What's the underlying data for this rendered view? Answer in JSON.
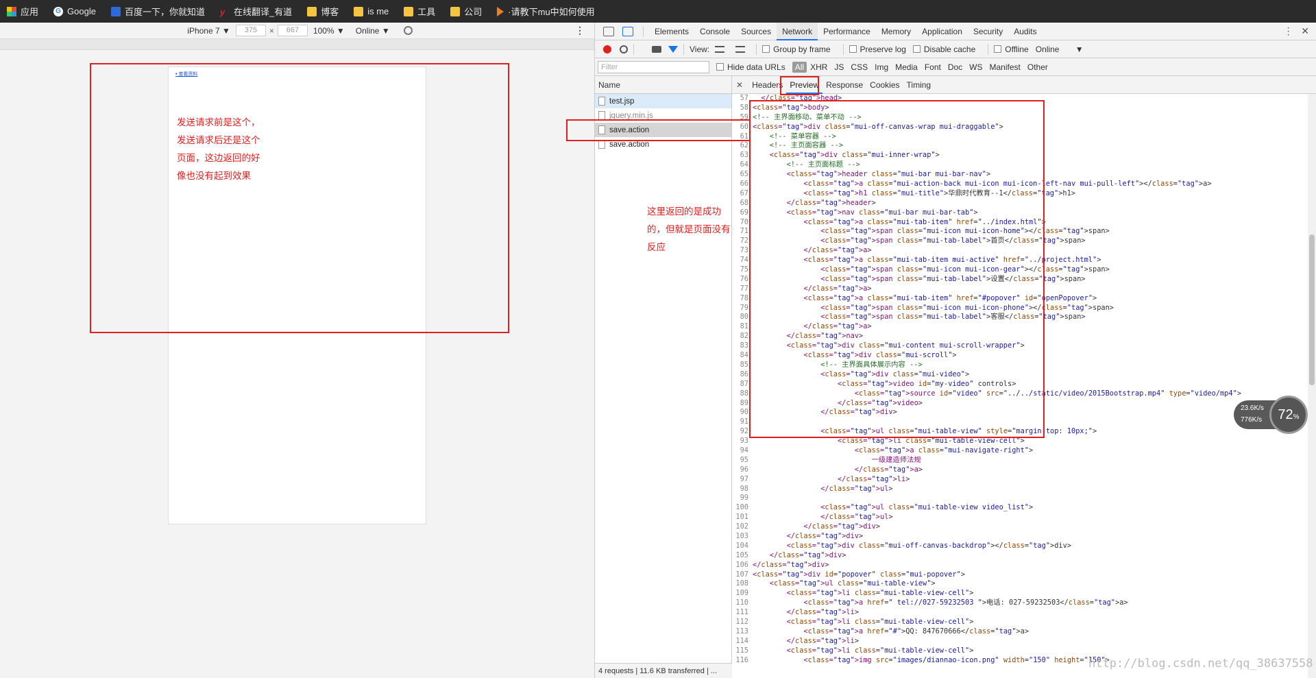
{
  "bookmarks": [
    {
      "label": "应用",
      "icon": "apps-icon"
    },
    {
      "label": "Google",
      "icon": "google-icon"
    },
    {
      "label": "百度一下，你就知道",
      "icon": "baidu-icon"
    },
    {
      "label": "在线翻译_有道",
      "icon": "youdao-icon"
    },
    {
      "label": "博客",
      "icon": "folder-icon"
    },
    {
      "label": "is me",
      "icon": "folder-icon"
    },
    {
      "label": "工具",
      "icon": "folder-icon"
    },
    {
      "label": "公司",
      "icon": "folder-icon"
    },
    {
      "label": "·请教下mu中如何使用",
      "icon": "bookmark-icon"
    }
  ],
  "device": {
    "model": "iPhone 7 ▼",
    "width": "375",
    "x": "×",
    "height": "667",
    "zoom": "100% ▼",
    "network": "Online ▼",
    "page_link": "查看资料"
  },
  "devtools": {
    "tabs": [
      "Elements",
      "Console",
      "Sources",
      "Network",
      "Performance",
      "Memory",
      "Application",
      "Security",
      "Audits"
    ],
    "toolbar": {
      "view": "View:",
      "group_by_frame": "Group by frame",
      "preserve_log": "Preserve log",
      "disable_cache": "Disable cache",
      "offline": "Offline",
      "online": "Online"
    },
    "filter_placeholder": "Filter",
    "hide_data_urls": "Hide data URLs",
    "types": [
      "All",
      "XHR",
      "JS",
      "CSS",
      "Img",
      "Media",
      "Font",
      "Doc",
      "WS",
      "Manifest",
      "Other"
    ],
    "name_header": "Name",
    "requests": [
      "test.jsp",
      "jquery.min.js",
      "save.action",
      "save.action"
    ],
    "status": "4 requests | 11.6 KB transferred | ...",
    "detail_tabs": [
      "Headers",
      "Preview",
      "Response",
      "Cookies",
      "Timing"
    ]
  },
  "code_lines": [
    {
      "n": "57",
      "h": "  </head>"
    },
    {
      "n": "58",
      "h": "<body>"
    },
    {
      "n": "59",
      "h": "<!-- 主界面移动、菜单不动 -->"
    },
    {
      "n": "60",
      "h": "<div class=\"mui-off-canvas-wrap mui-draggable\">"
    },
    {
      "n": "61",
      "h": "    <!-- 菜单容器 -->"
    },
    {
      "n": "62",
      "h": "    <!-- 主页面容器 -->"
    },
    {
      "n": "63",
      "h": "    <div class=\"mui-inner-wrap\">"
    },
    {
      "n": "64",
      "h": "        <!-- 主页面标题 -->"
    },
    {
      "n": "65",
      "h": "        <header class=\"mui-bar mui-bar-nav\">"
    },
    {
      "n": "66",
      "h": "            <a class=\"mui-action-back mui-icon mui-icon-left-nav mui-pull-left\"></a>"
    },
    {
      "n": "67",
      "h": "            <h1 class=\"mui-title\">华鼎时代教育--1</h1>"
    },
    {
      "n": "68",
      "h": "        </header>"
    },
    {
      "n": "69",
      "h": "        <nav class=\"mui-bar mui-bar-tab\">"
    },
    {
      "n": "70",
      "h": "            <a class=\"mui-tab-item\" href=\"../index.html\">"
    },
    {
      "n": "71",
      "h": "                <span class=\"mui-icon mui-icon-home\"></span>"
    },
    {
      "n": "72",
      "h": "                <span class=\"mui-tab-label\">首页</span>"
    },
    {
      "n": "73",
      "h": "            </a>"
    },
    {
      "n": "74",
      "h": "            <a class=\"mui-tab-item mui-active\" href=\"../project.html\">"
    },
    {
      "n": "75",
      "h": "                <span class=\"mui-icon mui-icon-gear\"></span>"
    },
    {
      "n": "76",
      "h": "                <span class=\"mui-tab-label\">设置</span>"
    },
    {
      "n": "77",
      "h": "            </a>"
    },
    {
      "n": "78",
      "h": "            <a class=\"mui-tab-item\" href=\"#popover\" id=\"openPopover\">"
    },
    {
      "n": "79",
      "h": "                <span class=\"mui-icon mui-icon-phone\"></span>"
    },
    {
      "n": "80",
      "h": "                <span class=\"mui-tab-label\">客服</span>"
    },
    {
      "n": "81",
      "h": "            </a>"
    },
    {
      "n": "82",
      "h": "        </nav>"
    },
    {
      "n": "83",
      "h": "        <div class=\"mui-content mui-scroll-wrapper\">"
    },
    {
      "n": "84",
      "h": "            <div class=\"mui-scroll\">"
    },
    {
      "n": "85",
      "h": "                <!-- 主界面具体展示内容 -->"
    },
    {
      "n": "86",
      "h": "                <div class=\"mui-video\">"
    },
    {
      "n": "87",
      "h": "                    <video id=\"my-video\" controls>"
    },
    {
      "n": "88",
      "h": "                        <source id=\"video\" src=\"../../static/video/2015Bootstrap.mp4\" type=\"video/mp4\">"
    },
    {
      "n": "89",
      "h": "                    </video>"
    },
    {
      "n": "90",
      "h": "                </div>"
    },
    {
      "n": "91",
      "h": ""
    },
    {
      "n": "92",
      "h": "                <ul class=\"mui-table-view\" style=\"margin-top: 10px;\">"
    },
    {
      "n": "93",
      "h": "                    <li class=\"mui-table-view-cell\">"
    },
    {
      "n": "94",
      "h": "                        <a class=\"mui-navigate-right\">"
    },
    {
      "n": "95",
      "h": "                            一级建造师法规"
    },
    {
      "n": "96",
      "h": "                        </a>"
    },
    {
      "n": "97",
      "h": "                    </li>"
    },
    {
      "n": "98",
      "h": "                </ul>"
    },
    {
      "n": "99",
      "h": ""
    },
    {
      "n": "100",
      "h": "                <ul class=\"mui-table-view video_list\">"
    },
    {
      "n": "101",
      "h": "                </ul>"
    },
    {
      "n": "102",
      "h": "            </div>"
    },
    {
      "n": "103",
      "h": "        </div>"
    },
    {
      "n": "104",
      "h": "        <div class=\"mui-off-canvas-backdrop\"></div>"
    },
    {
      "n": "105",
      "h": "    </div>"
    },
    {
      "n": "106",
      "h": "</div>"
    },
    {
      "n": "107",
      "h": "<div id=\"popover\" class=\"mui-popover\">"
    },
    {
      "n": "108",
      "h": "    <ul class=\"mui-table-view\">"
    },
    {
      "n": "109",
      "h": "        <li class=\"mui-table-view-cell\">"
    },
    {
      "n": "110",
      "h": "            <a href=\" tel://027-59232503 \">电话: 027-59232503</a>"
    },
    {
      "n": "111",
      "h": "        </li>"
    },
    {
      "n": "112",
      "h": "        <li class=\"mui-table-view-cell\">"
    },
    {
      "n": "113",
      "h": "            <a href=\"#\">QQ: 847670666</a>"
    },
    {
      "n": "114",
      "h": "        </li>"
    },
    {
      "n": "115",
      "h": "        <li class=\"mui-table-view-cell\">"
    },
    {
      "n": "116",
      "h": "            <img src=\"images/diannao-icon.png\" width=\"150\" height=\"150\">"
    }
  ],
  "annotations": {
    "left_note": [
      "发送请求前是这个，",
      "发送请求后还是这个",
      "页面，这边返回的好",
      "像也没有起到效果"
    ],
    "right_note": [
      "这里返回的是成功",
      "的，但就是页面没有",
      "反应"
    ]
  },
  "speed": {
    "up": "23.6K/s",
    "down": "776K/s",
    "percent": "72",
    "unit": "%"
  },
  "watermark": "http://blog.csdn.net/qq_38637558"
}
